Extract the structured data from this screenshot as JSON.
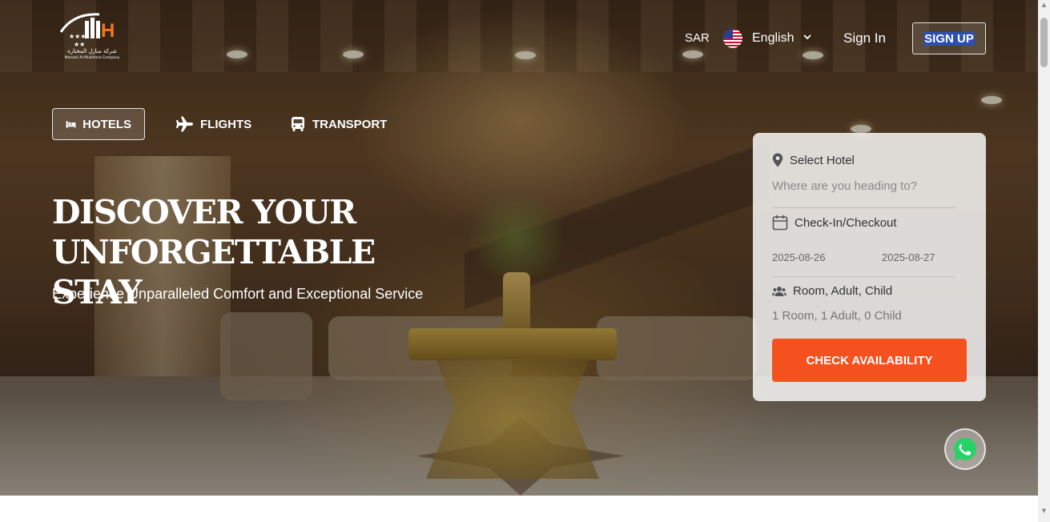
{
  "header": {
    "logo_text_ar": "شركة منازل المختارة",
    "logo_text_en": "Manazil Al-Mukhtara Company",
    "currency": "SAR",
    "language": "English",
    "signin_label": "Sign In",
    "signup_label": "SIGN UP"
  },
  "tabs": [
    {
      "label": "HOTELS",
      "icon": "bed-icon",
      "active": true
    },
    {
      "label": "FLIGHTS",
      "icon": "plane-icon",
      "active": false
    },
    {
      "label": "TRANSPORT",
      "icon": "bus-icon",
      "active": false
    }
  ],
  "hero": {
    "headline_line1": "DISCOVER YOUR",
    "headline_line2": "UNFORGETTABLE STAY",
    "subline": "Experience Unparalleled Comfort and Exceptional Service"
  },
  "search": {
    "hotel_label": "Select Hotel",
    "hotel_placeholder": "Where are you heading to?",
    "dates_label": "Check-In/Checkout",
    "checkin": "2025-08-26",
    "checkout": "2025-08-27",
    "guests_label": "Room, Adult, Child",
    "guests_value": "1 Room, 1 Adult, 0 Child",
    "cta_label": "CHECK AVAILABILITY"
  },
  "colors": {
    "accent": "#f4511e",
    "whatsapp": "#25d366",
    "selection": "#2d4fb0"
  },
  "icons": {
    "whatsapp": "whatsapp-icon",
    "location": "map-pin-icon",
    "calendar": "calendar-icon",
    "users": "users-icon",
    "chevron": "chevron-down-icon"
  }
}
